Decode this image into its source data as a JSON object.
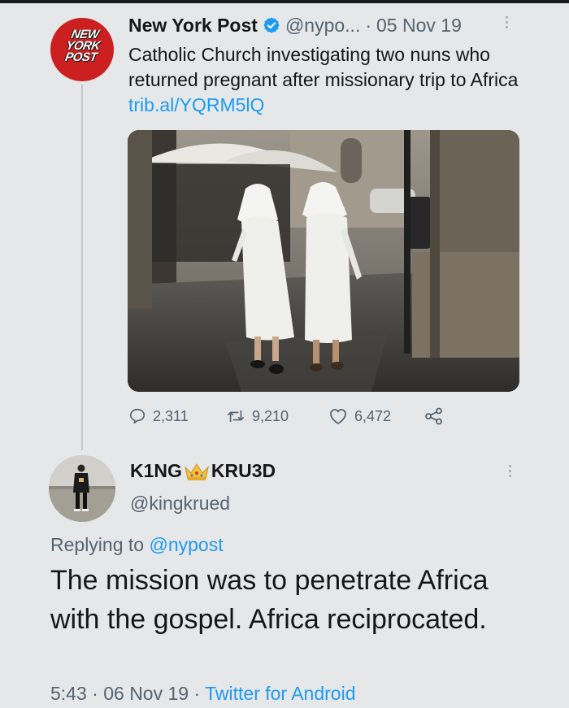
{
  "tweet": {
    "avatar_logo": [
      "NEW",
      "YORK",
      "POST"
    ],
    "display_name": "New York Post",
    "handle": "@nypo...",
    "separator": "·",
    "date": "05 Nov 19",
    "text_main": "Catholic Church investigating two nuns who returned pregnant after missionary trip to Africa",
    "link": "trib.al/YQRM5lQ",
    "image_icon": "photo-two-nuns-walking",
    "stats": {
      "replies": "2,311",
      "retweets": "9,210",
      "likes": "6,472"
    },
    "icons": {
      "reply": "speech-bubble-icon",
      "retweet": "retweet-icon",
      "like": "heart-icon",
      "share": "share-icon",
      "verified": "verified-badge-icon"
    }
  },
  "reply": {
    "display_name_part1": "K1NG",
    "display_name_emoji": "crown-emoji",
    "display_name_part2": "KRU3D",
    "handle": "@kingkrued",
    "replying_label": "Replying to",
    "replying_to": "@nypost",
    "text": "The mission was to penetrate Africa with the gospel. Africa reciprocated.",
    "time": "5:43",
    "date": "06 Nov 19",
    "separator": "·",
    "source": "Twitter for Android"
  },
  "colors": {
    "background": "#e6e7e9",
    "link_blue": "#1d9bf0",
    "secondary_text": "#536471",
    "nypost_red": "#cc1f1f"
  }
}
